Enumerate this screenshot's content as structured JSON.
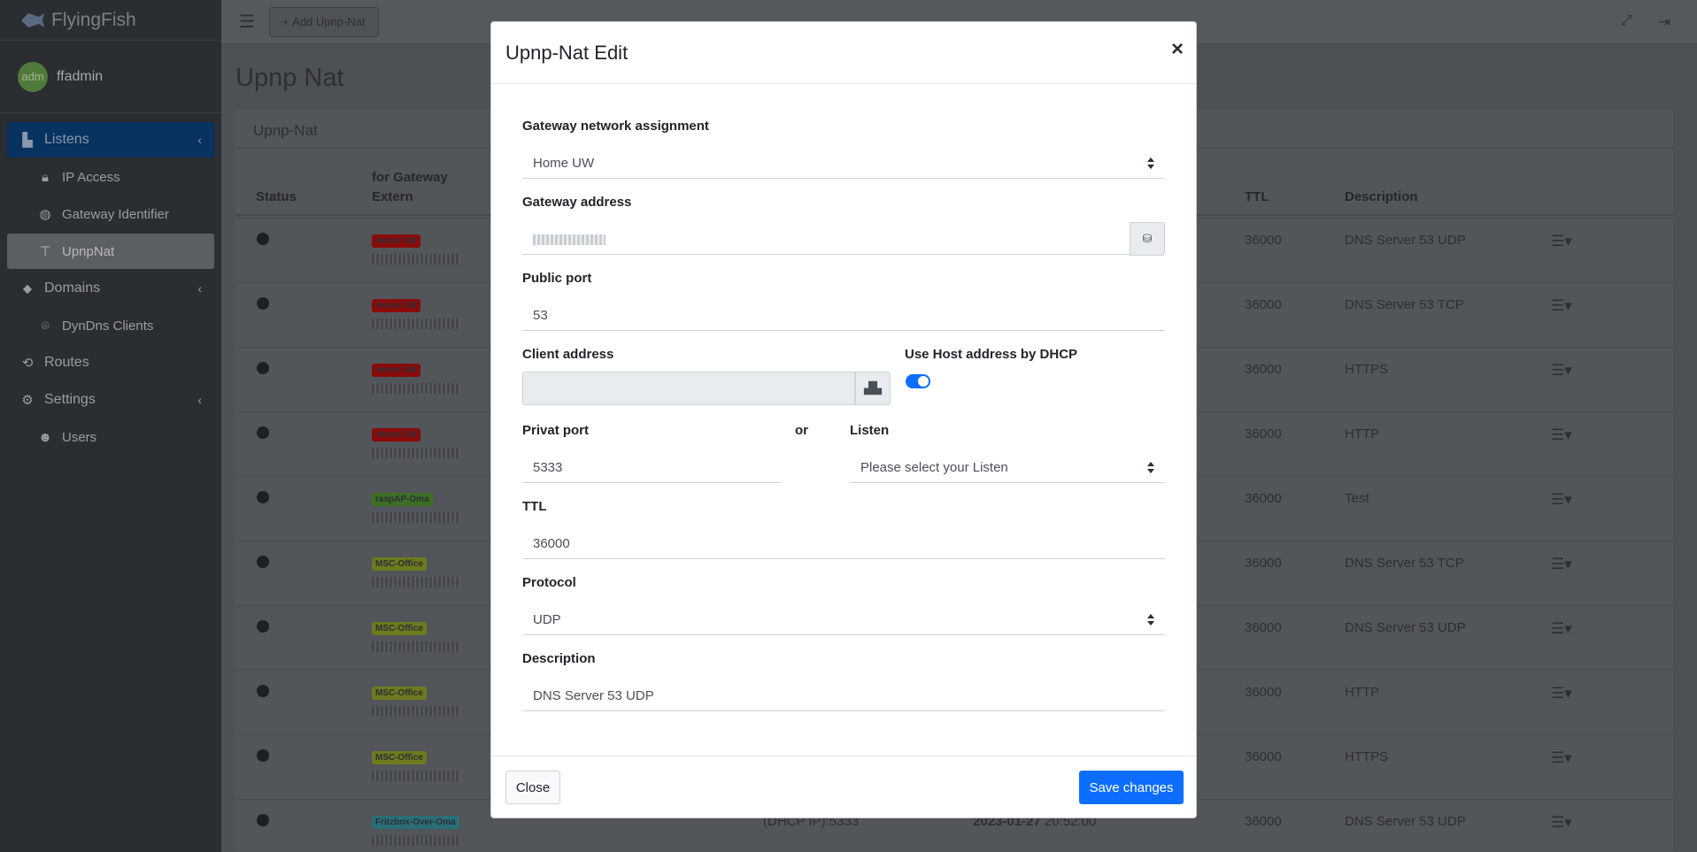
{
  "sidebar": {
    "brand": "FlyingFish",
    "avatar_text": "adm",
    "user_name": "ffadmin",
    "items": [
      {
        "label": "Listens",
        "icon": "listens-icon"
      },
      {
        "label": "IP Access",
        "icon": "lock-icon"
      },
      {
        "label": "Gateway Identifier",
        "icon": "globe-icon"
      },
      {
        "label": "UpnpNat",
        "icon": "signpost-icon"
      },
      {
        "label": "Domains",
        "icon": "tags-icon"
      },
      {
        "label": "DynDns Clients",
        "icon": "satellite-icon"
      },
      {
        "label": "Routes",
        "icon": "route-icon"
      },
      {
        "label": "Settings",
        "icon": "gears-icon"
      },
      {
        "label": "Users",
        "icon": "users-icon"
      }
    ]
  },
  "topbar": {
    "add_label": "Add Upnp-Nat"
  },
  "page": {
    "title": "Upnp Nat",
    "card_title": "Upnp-Nat",
    "columns": {
      "status": "Status",
      "gateway_line1": "for Gateway",
      "gateway_line2": "Extern",
      "ttl": "TTL",
      "description": "Description"
    },
    "rows": [
      {
        "badge": "Home UW",
        "badge_color": "#8b0b0b",
        "ttl": "36000",
        "description": "DNS Server 53 UDP"
      },
      {
        "badge": "Home UW",
        "badge_color": "#8b0b0b",
        "ttl": "36000",
        "description": "DNS Server 53 TCP"
      },
      {
        "badge": "Home UW",
        "badge_color": "#8b0b0b",
        "ttl": "36000",
        "description": "HTTPS"
      },
      {
        "badge": "Home UW",
        "badge_color": "#8b0b0b",
        "ttl": "36000",
        "description": "HTTP"
      },
      {
        "badge": "raspAP-Oma",
        "badge_color": "#3d6f24",
        "ttl": "36000",
        "description": "Test"
      },
      {
        "badge": "MSC-Office",
        "badge_color": "#6d7a1e",
        "ttl": "36000",
        "description": "DNS Server 53 TCP"
      },
      {
        "badge": "MSC-Office",
        "badge_color": "#6d7a1e",
        "ttl": "36000",
        "description": "DNS Server 53 UDP"
      },
      {
        "badge": "MSC-Office",
        "badge_color": "#6d7a1e",
        "ttl": "36000",
        "description": "HTTP"
      },
      {
        "badge": "MSC-Office",
        "badge_color": "#6d7a1e",
        "ttl": "36000",
        "description": "HTTPS"
      },
      {
        "badge": "Fritzbox-Over-Oma",
        "badge_color": "#2a6e78",
        "ttl": "36000",
        "description": "DNS Server 53 UDP",
        "client": "(DHCP IP):5333",
        "date": "2023-01-27",
        "time": "20:52:00"
      }
    ]
  },
  "modal": {
    "title": "Upnp-Nat Edit",
    "close_x": "×",
    "gateway_network_label": "Gateway network assignment",
    "gateway_network_value": "Home UW",
    "gateway_address_label": "Gateway address",
    "public_port_label": "Public port",
    "public_port_value": "53",
    "client_address_label": "Client address",
    "dhcp_label": "Use Host address by DHCP",
    "dhcp_enabled": true,
    "privat_port_label": "Privat port",
    "privat_port_value": "5333",
    "or_text": "or",
    "listen_label": "Listen",
    "listen_placeholder": "Please select your Listen",
    "ttl_label": "TTL",
    "ttl_value": "36000",
    "protocol_label": "Protocol",
    "protocol_value": "UDP",
    "description_label": "Description",
    "description_value": "DNS Server 53 UDP",
    "close_button": "Close",
    "save_button": "Save changes"
  }
}
